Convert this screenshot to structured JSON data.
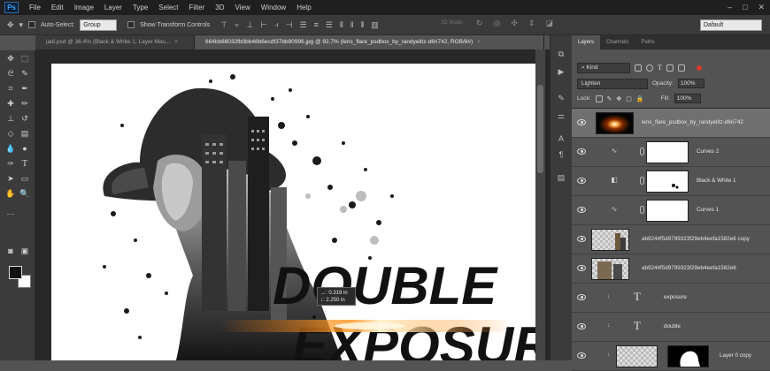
{
  "menubar": {
    "logo": "Ps",
    "items": [
      "File",
      "Edit",
      "Image",
      "Layer",
      "Type",
      "Select",
      "Filter",
      "3D",
      "View",
      "Window",
      "Help"
    ],
    "window_buttons": [
      "–",
      "□",
      "✕"
    ]
  },
  "options": {
    "auto_select_label": "Auto-Select:",
    "auto_select_value": "Group",
    "transform_controls_label": "Show Transform Controls",
    "mode3d_label": "3D Mode:",
    "workspace": "Dafault"
  },
  "tabs": [
    {
      "label": "jadi.psd @ 36.4% (Black & White 1, Layer Mas..."
    },
    {
      "label": "664bb88032fb0bb48b6ecdf37bb90996.jpg @ 92.7% (lens_flare_psdbox_by_randyelitz-d6ri742, RGB/8#)"
    }
  ],
  "canvas": {
    "headline_line1": "DOUBLE",
    "headline_line2": "EXPOSURE",
    "tooltip_line1": "→: 0.319 in",
    "tooltip_line2": "↓: 2.250 in"
  },
  "panel": {
    "tabs": [
      "Layers",
      "Channels",
      "Paths"
    ],
    "kind_label": "Kind",
    "blend_mode": "Lighten",
    "opacity_label": "Opacity:",
    "opacity_value": "100%",
    "lock_label": "Lock:",
    "fill_label": "Fill:",
    "fill_value": "100%"
  },
  "layers": [
    {
      "name": "lens_flare_psdbox_by_randyelitz-d6ri742",
      "type": "image",
      "selected": true
    },
    {
      "name": "Curves 2",
      "type": "adjustment"
    },
    {
      "name": "Black & White 1",
      "type": "adjustment"
    },
    {
      "name": "Curves 1",
      "type": "adjustment"
    },
    {
      "name": "ab9244f5d9799323f29eb4eefa1582e6  copy",
      "type": "image"
    },
    {
      "name": "ab9244f5d9799323f29eb4eefa1582e6",
      "type": "image"
    },
    {
      "name": "exposure",
      "type": "text"
    },
    {
      "name": "double",
      "type": "text"
    },
    {
      "name": "Layer 0 copy",
      "type": "masked"
    }
  ],
  "colors": {
    "foreground": "#121212",
    "background": "#ffffff",
    "accent": "#31a8ff"
  }
}
